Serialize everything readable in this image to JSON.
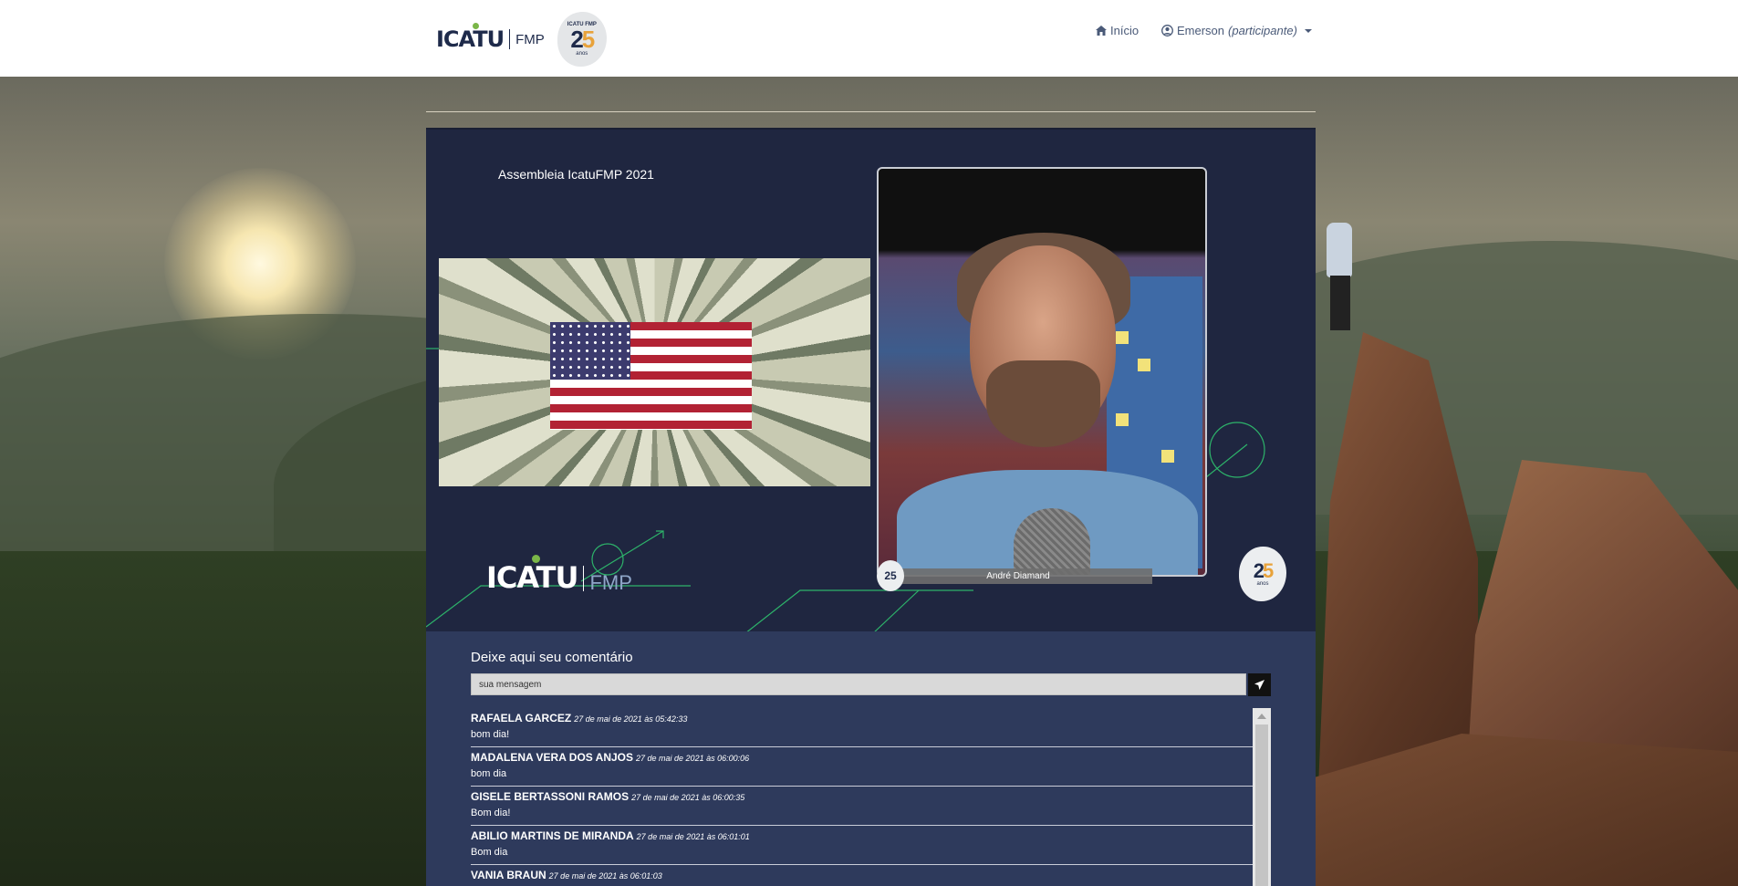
{
  "header": {
    "logo_text": "ICATU",
    "logo_suffix": "FMP",
    "badge_small": "ICATU FMP",
    "badge_number_a": "2",
    "badge_number_b": "5",
    "badge_anos": "anos",
    "nav_home": "Início",
    "nav_user_name": "Emerson",
    "nav_user_role": "(participante)"
  },
  "video": {
    "title": "Assembleia IcatuFMP 2021",
    "speaker_name": "André Diamand",
    "logo_text": "ICATU",
    "logo_suffix": "FMP",
    "badge_small_text": "25",
    "badge_number_a": "2",
    "badge_number_b": "5",
    "badge_anos": "anos"
  },
  "comments": {
    "title": "Deixe aqui seu comentário",
    "input_placeholder": "sua mensagem",
    "items": [
      {
        "author": "RAFAELA GARCEZ",
        "timestamp": "27 de mai de 2021 às 05:42:33",
        "text": "bom dia!"
      },
      {
        "author": "MADALENA VERA DOS ANJOS",
        "timestamp": "27 de mai de 2021 às 06:00:06",
        "text": "bom dia"
      },
      {
        "author": "GISELE BERTASSONI RAMOS",
        "timestamp": "27 de mai de 2021 às 06:00:35",
        "text": "Bom dia!"
      },
      {
        "author": "ABILIO MARTINS DE MIRANDA",
        "timestamp": "27 de mai de 2021 às 06:01:01",
        "text": "Bom dia"
      },
      {
        "author": "VANIA BRAUN",
        "timestamp": "27 de mai de 2021 às 06:01:03",
        "text": ""
      }
    ]
  },
  "icons": {
    "home": "home-icon",
    "user": "user-circle-icon",
    "caret": "caret-down-icon",
    "send": "send-icon"
  },
  "colors": {
    "navy": "#1e2a4a",
    "panel": "#2e3a5c",
    "video_bg": "#1f2640",
    "accent_green": "#7ab648",
    "accent_orange": "#e8a23a"
  }
}
